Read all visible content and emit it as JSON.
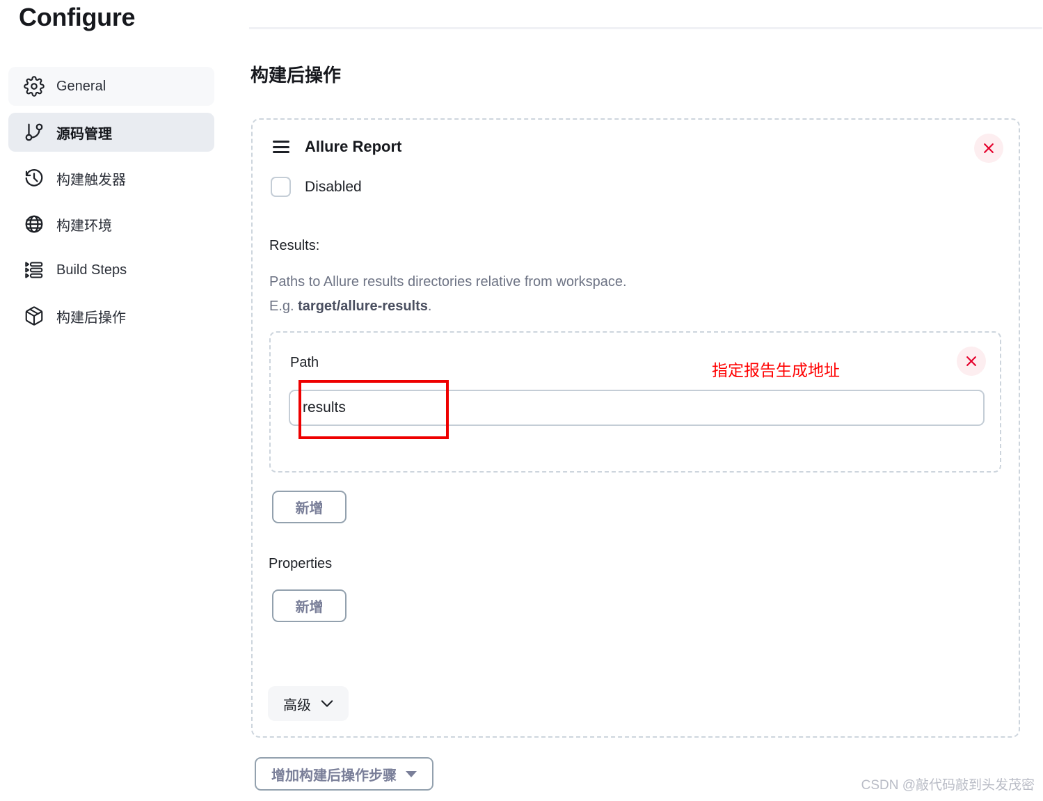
{
  "page": {
    "title": "Configure"
  },
  "sidebar": {
    "items": [
      {
        "label": "General",
        "icon": "gear-icon",
        "state": "hover"
      },
      {
        "label": "源码管理",
        "icon": "git-branch-icon",
        "state": "active"
      },
      {
        "label": "构建触发器",
        "icon": "clock-icon",
        "state": "default"
      },
      {
        "label": "构建环境",
        "icon": "globe-icon",
        "state": "default"
      },
      {
        "label": "Build Steps",
        "icon": "list-steps-icon",
        "state": "default"
      },
      {
        "label": "构建后操作",
        "icon": "package-icon",
        "state": "default"
      }
    ]
  },
  "main": {
    "section_title": "构建后操作",
    "panel": {
      "title": "Allure Report",
      "drag_handle_icon": "hamburger-icon",
      "delete_icon": "close-icon",
      "disabled_checkbox": {
        "label": "Disabled",
        "checked": false
      },
      "results": {
        "label": "Results:",
        "description_line1": "Paths to Allure results directories relative from workspace.",
        "description_line2_prefix": "E.g. ",
        "description_line2_strong": "target/allure-results",
        "description_line2_suffix": "."
      },
      "path_entry": {
        "label": "Path",
        "value": "results",
        "placeholder": "",
        "delete_icon": "close-icon"
      },
      "add_path_button": "新增",
      "properties_label": "Properties",
      "add_properties_button": "新增",
      "advanced_button": {
        "label": "高级",
        "icon": "chevron-down-icon"
      }
    },
    "add_step_button": {
      "label": "增加构建后操作步骤",
      "icon": "caret-down-icon"
    }
  },
  "annotation": {
    "note_text": "指定报告生成地址",
    "note_color": "#ff0000",
    "highlight_box_color": "#ee0000"
  },
  "watermark": {
    "text": "CSDN @敲代码敲到头发茂密"
  },
  "colors": {
    "text_primary": "#16181d",
    "text_muted": "#6d7384",
    "active_nav_bg": "#e9ecf1",
    "hover_nav_bg": "#f7f8fa",
    "dashed_border": "#cdd5dd",
    "close_bg": "#fdeef0",
    "close_fg": "#e4002b",
    "button_border": "#93a1ae",
    "button_text": "#7a7f99"
  }
}
